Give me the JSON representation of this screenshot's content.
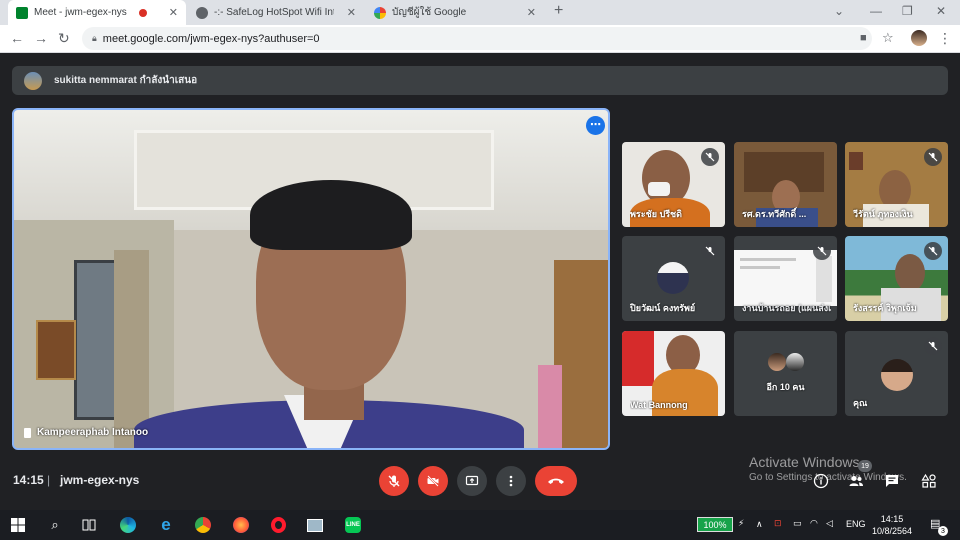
{
  "browser": {
    "tabs": [
      {
        "label": "Meet - jwm-egex-nys",
        "active": true
      },
      {
        "label": "-:- SafeLog HotSpot Wifi Internet",
        "active": false
      },
      {
        "label": "บัญชีผู้ใช้ Google",
        "active": false
      }
    ],
    "new_tab_icon": "plus-icon",
    "url": "meet.google.com/jwm-egex-nys?authuser=0"
  },
  "meet": {
    "presenting_text": "sukitta nemmarat กำลังนำเสนอ",
    "main_video": {
      "name": "Kampeeraphab Intanoo"
    },
    "tiles": [
      {
        "name": "พระชัย ปรีชดิ",
        "muted": true
      },
      {
        "name": "รศ.ดร.ทวีศักดิ์ ...",
        "muted": false
      },
      {
        "name": "วีรัตน์ ภูทองเงิน",
        "muted": true
      },
      {
        "name": "ปิยวัฒน์ คงทรัพย์",
        "muted": true
      },
      {
        "name": "งานบ้านรถอย (แผนส่งเสริม...",
        "muted": true
      },
      {
        "name": "รังสรรค์ วิพุกเจ้ม",
        "muted": true
      },
      {
        "name": "Wat Bannong",
        "muted": false
      },
      {
        "name": "อีก 10 คน",
        "muted": false
      },
      {
        "name": "คุณ",
        "muted": true
      }
    ],
    "time": "14:15",
    "separator": "|",
    "meeting_code": "jwm-egex-nys",
    "participants_count": "19",
    "colors": {
      "mic_off_red": "#ea4335",
      "focus_blue": "#8ab4f8",
      "bar": "#202124"
    }
  },
  "watermark": {
    "line1": "Activate Windows",
    "line2": "Go to Settings to activate Windows."
  },
  "taskbar": {
    "battery": "100%",
    "lang": "ENG",
    "clock_time": "14:15",
    "clock_date": "10/8/2564",
    "notifications": "3"
  }
}
